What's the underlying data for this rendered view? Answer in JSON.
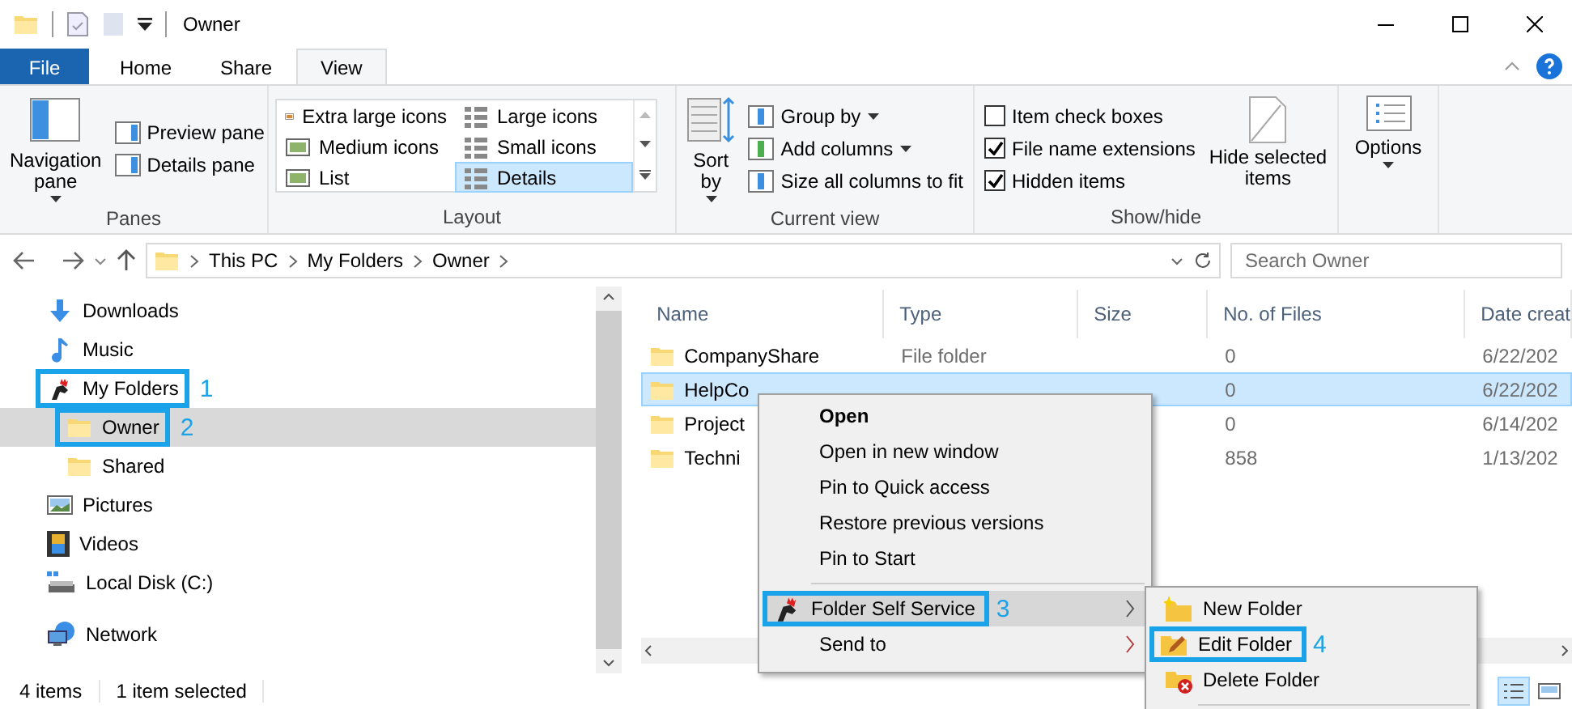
{
  "window": {
    "title": "Owner"
  },
  "ribbon_tabs": [
    {
      "label": "File",
      "kind": "file",
      "selected": false
    },
    {
      "label": "Home",
      "kind": "tab",
      "selected": false
    },
    {
      "label": "Share",
      "kind": "tab",
      "selected": false
    },
    {
      "label": "View",
      "kind": "tab",
      "selected": true
    }
  ],
  "panes": {
    "label": "Panes",
    "navigation_pane": "Navigation pane",
    "items": [
      "Preview pane",
      "Details pane"
    ]
  },
  "layout": {
    "label": "Layout",
    "options": [
      {
        "label": "Extra large icons",
        "selected": false
      },
      {
        "label": "Large icons",
        "selected": false
      },
      {
        "label": "Medium icons",
        "selected": false
      },
      {
        "label": "Small icons",
        "selected": false
      },
      {
        "label": "List",
        "selected": false
      },
      {
        "label": "Details",
        "selected": true
      }
    ]
  },
  "current_view": {
    "label": "Current view",
    "sort_by": "Sort by",
    "items": [
      {
        "label": "Group by",
        "kind": "dropdown"
      },
      {
        "label": "Add columns",
        "kind": "dropdown"
      },
      {
        "label": "Size all columns to fit",
        "kind": "button"
      }
    ]
  },
  "show_hide": {
    "label": "Show/hide",
    "checkboxes": [
      {
        "label": "Item check boxes",
        "checked": false
      },
      {
        "label": "File name extensions",
        "checked": true
      },
      {
        "label": "Hidden items",
        "checked": true
      }
    ],
    "hide_selected": "Hide selected items"
  },
  "options": {
    "label": "Options"
  },
  "address": {
    "path": [
      "This PC",
      "My Folders",
      "Owner"
    ]
  },
  "search": {
    "placeholder": "Search Owner"
  },
  "nav_tree": [
    {
      "label": "Downloads",
      "kind": "download",
      "selected": false
    },
    {
      "label": "Music",
      "kind": "music",
      "selected": false
    },
    {
      "label": "My Folders",
      "kind": "brand",
      "selected": false,
      "marker": "1",
      "children": [
        {
          "label": "Owner",
          "kind": "folder",
          "selected": true,
          "marker": "2"
        },
        {
          "label": "Shared",
          "kind": "folder",
          "selected": false
        }
      ]
    },
    {
      "label": "Pictures",
      "kind": "pictures",
      "selected": false
    },
    {
      "label": "Videos",
      "kind": "videos",
      "selected": false
    },
    {
      "label": "Local Disk (C:)",
      "kind": "disk",
      "selected": false
    },
    {
      "label": "Network",
      "kind": "network",
      "selected": false
    }
  ],
  "table": {
    "columns": [
      "Name",
      "Type",
      "Size",
      "No. of Files",
      "Date creat"
    ],
    "rows": [
      {
        "name": "CompanyShare",
        "type": "File folder",
        "files": "0",
        "date": "6/22/202",
        "selected": false
      },
      {
        "name": "HelpCo",
        "files": "0",
        "date": "6/22/202",
        "selected": true
      },
      {
        "name": "Project",
        "files": "0",
        "date": "6/14/202",
        "selected": false
      },
      {
        "name": "Techni",
        "files": "858",
        "date": "1/13/202",
        "selected": false
      }
    ]
  },
  "context_menu": {
    "sections": [
      [
        {
          "label": "Open",
          "kind": "default",
          "selected": false
        },
        {
          "label": "Open in new window",
          "kind": "item",
          "selected": false
        },
        {
          "label": "Pin to Quick access",
          "kind": "item",
          "selected": false
        },
        {
          "label": "Restore previous versions",
          "kind": "item",
          "selected": false
        },
        {
          "label": "Pin to Start",
          "kind": "item",
          "selected": false
        }
      ],
      [
        {
          "label": "Folder Self Service",
          "kind": "submenu",
          "selected": true,
          "marker": "3"
        },
        {
          "label": "Send to",
          "kind": "submenu",
          "selected": false
        }
      ]
    ]
  },
  "submenu": {
    "items": [
      {
        "label": "New Folder",
        "kind": "new",
        "selected": false
      },
      {
        "label": "Edit Folder",
        "kind": "edit",
        "selected": false,
        "marker": "4"
      },
      {
        "label": "Delete Folder",
        "kind": "delete",
        "selected": false
      }
    ]
  },
  "status_bar": {
    "items": [
      "4 items",
      "1 item selected"
    ],
    "views": [
      {
        "kind": "details",
        "selected": true
      },
      {
        "kind": "large",
        "selected": false
      }
    ]
  }
}
